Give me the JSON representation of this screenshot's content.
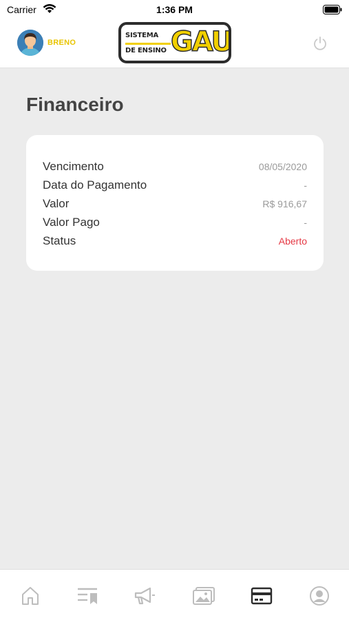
{
  "status_bar": {
    "carrier": "Carrier",
    "time": "1:36 PM"
  },
  "header": {
    "user_name": "BRENO",
    "logo": {
      "line1": "SISTEMA",
      "line2": "DE ENSINO",
      "word": "GAU"
    },
    "icons": {
      "avatar": "user-avatar",
      "logout": "power-icon"
    }
  },
  "main": {
    "title": "Financeiro",
    "card": {
      "rows": [
        {
          "label": "Vencimento",
          "value": "08/05/2020"
        },
        {
          "label": "Data do Pagamento",
          "value": "-"
        },
        {
          "label": "Valor",
          "value": "R$ 916,67"
        },
        {
          "label": "Valor Pago",
          "value": "-"
        },
        {
          "label": "Status",
          "value": "Aberto"
        }
      ]
    }
  },
  "tab_bar": {
    "tabs": [
      {
        "icon": "home-icon",
        "active": false
      },
      {
        "icon": "list-bookmark-icon",
        "active": false
      },
      {
        "icon": "megaphone-icon",
        "active": false
      },
      {
        "icon": "gallery-icon",
        "active": false
      },
      {
        "icon": "credit-card-icon",
        "active": true
      },
      {
        "icon": "profile-icon",
        "active": false
      }
    ]
  },
  "colors": {
    "accent": "#f1cf00",
    "status_open": "#e53945",
    "background": "#ececec"
  }
}
